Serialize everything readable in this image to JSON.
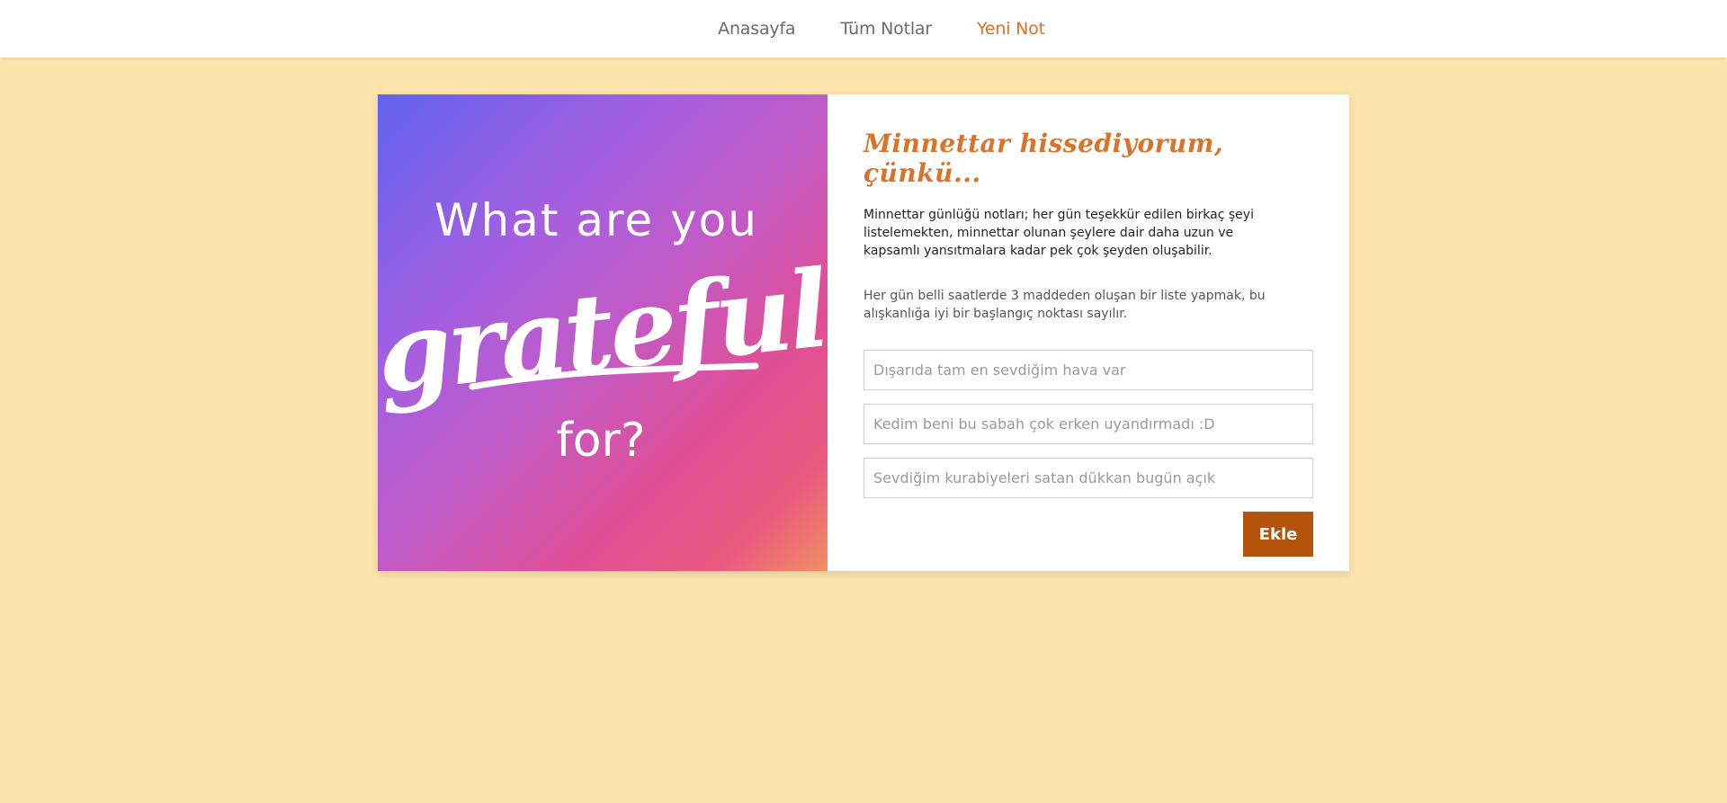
{
  "nav": {
    "items": [
      {
        "label": "Anasayfa",
        "active": false
      },
      {
        "label": "Tüm Notlar",
        "active": false
      },
      {
        "label": "Yeni Not",
        "active": true
      }
    ]
  },
  "hero": {
    "line1": "What are you",
    "line2": "grateful",
    "line3": "for?"
  },
  "form": {
    "title": "Minnettar hissediyorum, çünkü...",
    "description": "Minnettar günlüğü notları; her gün teşekkür edilen birkaç şeyi listelemekten, minnettar olunan şeylere dair daha uzun ve kapsamlı yansıtmalara kadar pek çok şeyden oluşabilir.",
    "description2": "Her gün belli saatlerde 3 maddeden oluşan bir liste yapmak, bu alışkanlığa iyi bir başlangıç noktası sayılır.",
    "inputs": [
      {
        "placeholder": "Dışarıda tam en sevdiğim hava var"
      },
      {
        "placeholder": "Kedim beni bu sabah çok erken uyandırmadı :D"
      },
      {
        "placeholder": "Sevdiğim kurabiyeleri satan dükkan bugün açık"
      }
    ],
    "submit_label": "Ekle"
  },
  "colors": {
    "background": "#fde4ad",
    "accent": "#d9722b",
    "button": "#b3530c"
  }
}
